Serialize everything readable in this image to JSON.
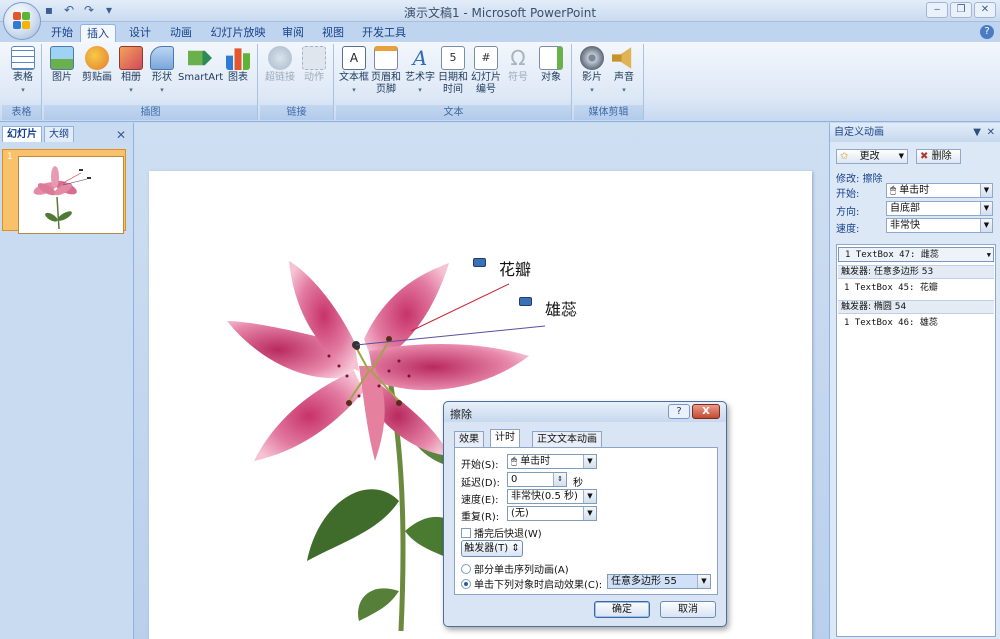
{
  "window": {
    "title": "演示文稿1 - Microsoft PowerPoint"
  },
  "tabs": [
    {
      "label": "开始"
    },
    {
      "label": "插入"
    },
    {
      "label": "设计"
    },
    {
      "label": "动画"
    },
    {
      "label": "幻灯片放映"
    },
    {
      "label": "审阅"
    },
    {
      "label": "视图"
    },
    {
      "label": "开发工具"
    }
  ],
  "active_tab": "插入",
  "ribbon": {
    "groups": {
      "tables": "表格",
      "illustrations": "插图",
      "links": "链接",
      "text": "文本",
      "media": "媒体剪辑"
    },
    "buttons": {
      "table": "表格",
      "picture": "图片",
      "clipart": "剪贴画",
      "album": "相册",
      "shapes": "形状",
      "smartart": "SmartArt",
      "chart": "图表",
      "hyperlink": "超链接",
      "action": "动作",
      "textbox_l1": "文本框",
      "header_l1": "页眉和",
      "header_l2": "页脚",
      "wordart": "艺术字",
      "datetime_l1": "日期和",
      "datetime_l2": "时间",
      "slidenum_l1": "幻灯片",
      "slidenum_l2": "编号",
      "symbol": "符号",
      "object": "对象",
      "movie": "影片",
      "sound": "声音"
    }
  },
  "left_panel": {
    "tab_slides": "幻灯片",
    "tab_outline": "大纲",
    "slide_number": "1"
  },
  "slide": {
    "label_petal": "花瓣",
    "label_stamen": "雄蕊"
  },
  "dialog": {
    "title": "擦除",
    "help": "?",
    "close": "X",
    "tabs": [
      "效果",
      "计时",
      "正文文本动画"
    ],
    "start_label": "开始(S):",
    "start_value": "单击时",
    "delay_label": "延迟(D):",
    "delay_value": "0",
    "delay_unit": "秒",
    "speed_label": "速度(E):",
    "speed_value": "非常快(0.5 秒)",
    "repeat_label": "重复(R):",
    "repeat_value": "(无)",
    "rewind_label": "播完后快退(W)",
    "triggers_button": "触发器(T)",
    "option_sequence": "部分单击序列动画(A)",
    "option_trigger": "单击下列对象时启动效果(C):",
    "trigger_object": "任意多边形 55",
    "ok": "确定",
    "cancel": "取消"
  },
  "custom_animation": {
    "title": "自定义动画",
    "change_button": "更改",
    "remove_button": "删除",
    "modify_label": "修改: 擦除",
    "start_label": "开始:",
    "start_value": "单击时",
    "direction_label": "方向:",
    "direction_value": "自底部",
    "speed_label": "速度:",
    "speed_value": "非常快",
    "items": [
      {
        "text": "1  TextBox 47: 雌蕊"
      },
      {
        "trigger": "触发器: 任意多边形 53"
      },
      {
        "text": "1  TextBox 45: 花瓣"
      },
      {
        "trigger": "触发器: 椭圆 54"
      },
      {
        "text": "1  TextBox 46: 雄蕊"
      }
    ]
  }
}
